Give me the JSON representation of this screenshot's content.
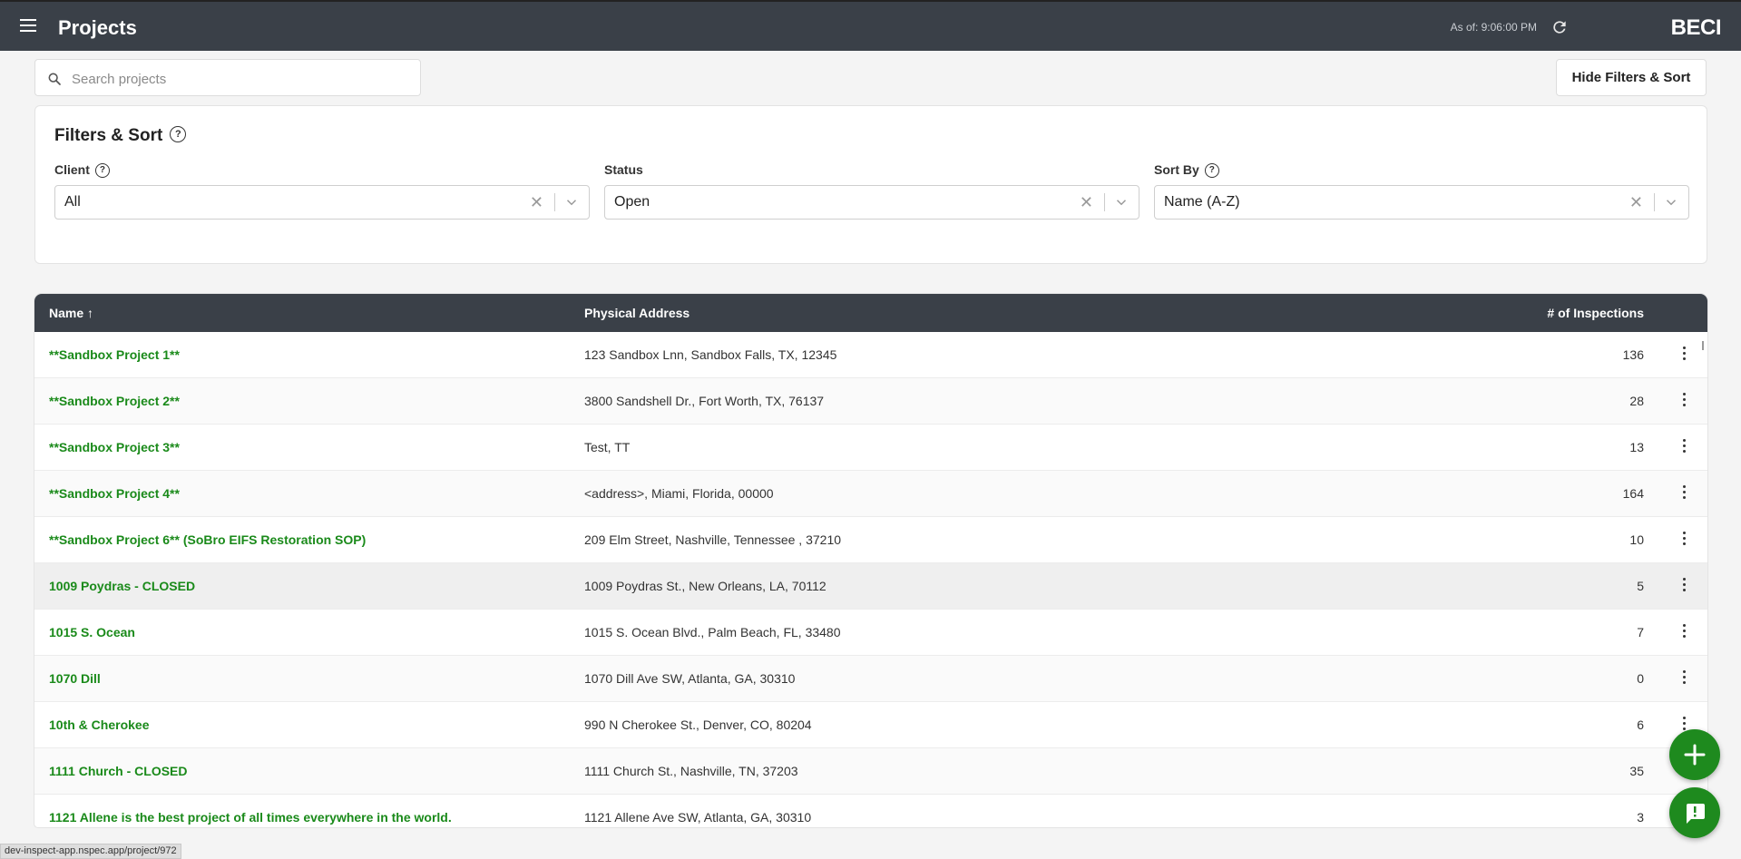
{
  "header": {
    "title": "Projects",
    "as_of": "As of: 9:06:00 PM",
    "brand": "BECI"
  },
  "search": {
    "placeholder": "Search projects",
    "value": ""
  },
  "toolbar": {
    "hide_filters_label": "Hide Filters & Sort"
  },
  "filters": {
    "title": "Filters & Sort",
    "client": {
      "label": "Client",
      "value": "All"
    },
    "status": {
      "label": "Status",
      "value": "Open"
    },
    "sort_by": {
      "label": "Sort By",
      "value": "Name (A-Z)"
    }
  },
  "table": {
    "columns": {
      "name": "Name ↑",
      "address": "Physical Address",
      "inspections": "# of Inspections"
    },
    "rows": [
      {
        "name": "**Sandbox Project 1**",
        "address": "123 Sandbox Lnn, Sandbox Falls, TX, 12345",
        "inspections": "136"
      },
      {
        "name": "**Sandbox Project 2**",
        "address": "3800 Sandshell Dr., Fort Worth, TX, 76137",
        "inspections": "28"
      },
      {
        "name": "**Sandbox Project 3**",
        "address": "Test, TT",
        "inspections": "13"
      },
      {
        "name": "**Sandbox Project 4**",
        "address": "<address>, Miami, Florida, 00000",
        "inspections": "164"
      },
      {
        "name": "**Sandbox Project 6** (SoBro EIFS Restoration SOP)",
        "address": "209 Elm Street, Nashville, Tennessee , 37210",
        "inspections": "10"
      },
      {
        "name": "1009 Poydras - CLOSED",
        "address": "1009 Poydras St., New Orleans, LA, 70112",
        "inspections": "5"
      },
      {
        "name": "1015 S. Ocean",
        "address": "1015 S. Ocean Blvd., Palm Beach, FL, 33480",
        "inspections": "7"
      },
      {
        "name": "1070 Dill",
        "address": "1070 Dill Ave SW, Atlanta, GA, 30310",
        "inspections": "0"
      },
      {
        "name": "10th & Cherokee",
        "address": "990 N Cherokee St., Denver, CO, 80204",
        "inspections": "6"
      },
      {
        "name": "1111 Church - CLOSED",
        "address": "1111 Church St., Nashville, TN, 37203",
        "inspections": "35"
      },
      {
        "name": "1121 Allene is the best project of all times everywhere in the world.",
        "address": "1121 Allene Ave SW, Atlanta, GA, 30310",
        "inspections": "3"
      }
    ]
  },
  "status_bar": {
    "url": "dev-inspect-app.nspec.app/project/972"
  },
  "colors": {
    "header_bg": "#3a4048",
    "link_green": "#1a8a1a",
    "fab_green": "#1e8a1e"
  },
  "icons": [
    "menu-icon",
    "refresh-icon",
    "search-icon",
    "help-icon",
    "clear-icon",
    "chevron-down-icon",
    "more-vert-icon",
    "plus-icon",
    "chat-icon"
  ]
}
